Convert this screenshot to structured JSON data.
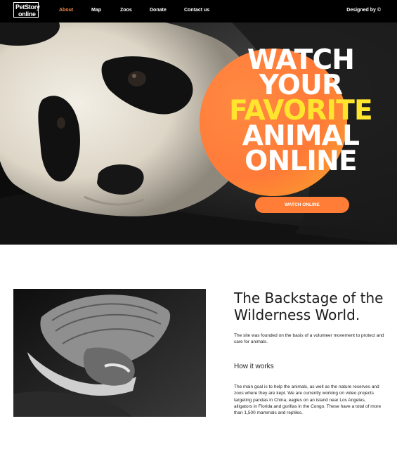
{
  "header": {
    "logo_line1": "PetStory",
    "logo_line2": "online",
    "nav": [
      {
        "label": "About",
        "active": true
      },
      {
        "label": "Map",
        "active": false
      },
      {
        "label": "Zoos",
        "active": false
      },
      {
        "label": "Donate",
        "active": false
      },
      {
        "label": "Contact us",
        "active": false
      }
    ],
    "designed_by": "Designed by ©"
  },
  "hero": {
    "title_line1": "WATCH",
    "title_line2": "YOUR",
    "title_line3": "FAVORITE",
    "title_line4": "ANIMAL",
    "title_line5": "ONLINE",
    "button_label": "WATCH ONLINE",
    "accent_color": "#ff7d36",
    "highlight_color": "#ffe52e"
  },
  "content": {
    "title": "The Backstage of the Wilderness World.",
    "intro": "The site was founded on the basis of a volunteer movement to protect and care for animals.",
    "how_title": "How it works",
    "goal": "The main goal is to help the animals, as well as the nature reserves and zoos where they are kept. We are currently working on video projects targeting pandas in China, eagles on an island near Los Angeles, alligators in Florida and gorillas in the Congo. These have a total of more than 1,500 mammals and reptiles."
  }
}
